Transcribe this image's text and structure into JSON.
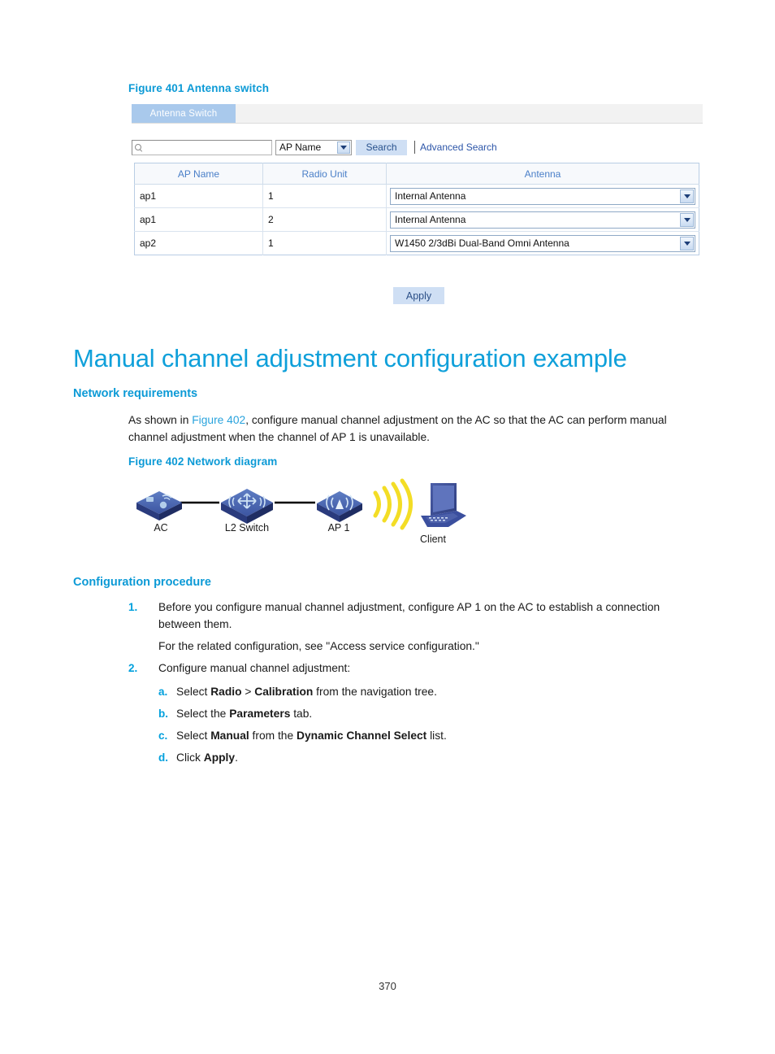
{
  "figure401": {
    "caption": "Figure 401 Antenna switch",
    "tab_label": "Antenna Switch",
    "search": {
      "value": "",
      "placeholder": "",
      "field_selector": "AP Name",
      "search_button": "Search",
      "advanced_search": "Advanced Search",
      "search_icon": "search-icon"
    },
    "table": {
      "headers": [
        "AP Name",
        "Radio Unit",
        "Antenna"
      ],
      "rows": [
        {
          "ap_name": "ap1",
          "radio_unit": "1",
          "antenna": "Internal Antenna"
        },
        {
          "ap_name": "ap1",
          "radio_unit": "2",
          "antenna": "Internal Antenna"
        },
        {
          "ap_name": "ap2",
          "radio_unit": "1",
          "antenna": "W1450 2/3dBi Dual-Band Omni Antenna"
        }
      ]
    },
    "apply_button": "Apply"
  },
  "heading": "Manual channel adjustment configuration example",
  "network_requirements": {
    "title": "Network requirements",
    "text_before_link": "As shown in ",
    "link": "Figure 402",
    "text_after_link": ", configure manual channel adjustment on the AC so that the AC can perform manual channel adjustment when the channel of AP 1 is unavailable."
  },
  "figure402": {
    "caption": "Figure 402 Network diagram",
    "devices": [
      {
        "label": "AC",
        "icon": "ac-controller-icon"
      },
      {
        "label": "L2 Switch",
        "icon": "switch-icon"
      },
      {
        "label": "AP 1",
        "icon": "access-point-icon"
      },
      {
        "label": "Client",
        "icon": "laptop-icon"
      }
    ],
    "wireless_signal_icon": "wifi-signal-icon"
  },
  "configuration_procedure": {
    "title": "Configuration procedure",
    "steps": [
      {
        "num": "1.",
        "text": "Before you configure manual channel adjustment, configure AP 1 on the AC to establish a connection between them.",
        "continuation": "For the related configuration, see \"Access service configuration.\""
      },
      {
        "num": "2.",
        "text": "Configure manual channel adjustment:",
        "substeps": [
          {
            "num": "a.",
            "p1": "Select ",
            "b1": "Radio",
            "p2": " > ",
            "b2": "Calibration",
            "p3": " from the navigation tree."
          },
          {
            "num": "b.",
            "p1": "Select the ",
            "b1": "Parameters",
            "p2": " tab.",
            "b2": "",
            "p3": ""
          },
          {
            "num": "c.",
            "p1": "Select ",
            "b1": "Manual",
            "p2": " from the ",
            "b2": "Dynamic Channel Select",
            "p3": " list."
          },
          {
            "num": "d.",
            "p1": "Click ",
            "b1": "Apply",
            "p2": ".",
            "b2": "",
            "p3": ""
          }
        ]
      }
    ]
  },
  "page_number": "370",
  "colors": {
    "heading_blue": "#0fa0da",
    "caption_blue": "#0c9ad6",
    "link_blue": "#29a3dd",
    "tab_blue": "#a9c9ec",
    "button_blue": "#cfdff4",
    "table_header_text": "#4a7fc8",
    "device_blue": "#3b4f9e",
    "signal_yellow": "#f5e03c"
  }
}
